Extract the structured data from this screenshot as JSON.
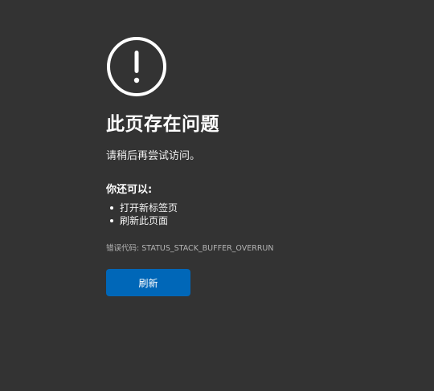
{
  "error": {
    "icon": "exclamation-circle-icon",
    "title": "此页存在问题",
    "subtitle": "请稍后再尝试访问。",
    "try_heading": "你还可以:",
    "suggestions": [
      {
        "label": "打开新标签页"
      },
      {
        "label": "刷新此页面"
      }
    ],
    "code_label": "错误代码:",
    "code_value": "STATUS_STACK_BUFFER_OVERRUN"
  },
  "actions": {
    "refresh_label": "刷新"
  },
  "colors": {
    "background": "#333333",
    "accent": "#0067b8",
    "text": "#ffffff",
    "muted": "#b4b4b4"
  }
}
